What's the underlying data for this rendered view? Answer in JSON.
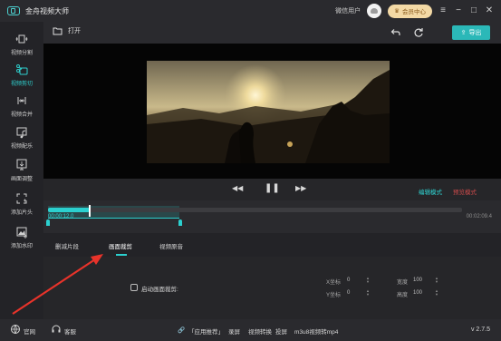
{
  "app": {
    "title": "金舟视频大师",
    "user_name": "微信用户",
    "member_label": "会员中心",
    "menu_icon": "menu-icon",
    "min_icon": "minimize-icon",
    "max_icon": "maximize-icon",
    "close_icon": "close-icon"
  },
  "sidebar": {
    "items": [
      {
        "label": "视频分割",
        "icon": "split-icon"
      },
      {
        "label": "视频剪切",
        "icon": "cut-icon",
        "active": true
      },
      {
        "label": "视频合并",
        "icon": "merge-icon"
      },
      {
        "label": "视频配乐",
        "icon": "music-icon"
      },
      {
        "label": "画面调整",
        "icon": "adjust-icon"
      },
      {
        "label": "添加片头",
        "icon": "intro-icon"
      },
      {
        "label": "添加水印",
        "icon": "watermark-icon"
      }
    ]
  },
  "toolbar": {
    "open_label": "打开",
    "export_label": "导出"
  },
  "player": {
    "edit_mode": "编辑模式",
    "preview_mode": "预览模式"
  },
  "timeline": {
    "current_time": "00:00:12.0",
    "total_time": "00:02:09.4",
    "progress": 0.1,
    "clip_end": 0.32
  },
  "tabs": [
    {
      "label": "删减片段",
      "active": false
    },
    {
      "label": "画面裁剪",
      "active": true
    },
    {
      "label": "视频原音",
      "active": false
    }
  ],
  "crop_panel": {
    "enable_label": "启动画面裁剪:",
    "x_label": "X坐标",
    "x_value": "0",
    "y_label": "Y坐标",
    "y_value": "0",
    "width_label": "宽度",
    "width_value": "100",
    "height_label": "高度",
    "height_value": "100"
  },
  "statusbar": {
    "website": "官网",
    "support": "客服",
    "recommend": "「应用推荐」",
    "link_record": "录屏",
    "link_convert": "视频转换",
    "link_capture": "投屏",
    "link_m3u8": "m3u8视频转mp4",
    "version": "v 2.7.5"
  },
  "colors": {
    "accent": "#2bd0cf",
    "export_button": "#2bb8b8",
    "member_badge": "#f3d9a5",
    "annotation_arrow": "#e8332a"
  }
}
